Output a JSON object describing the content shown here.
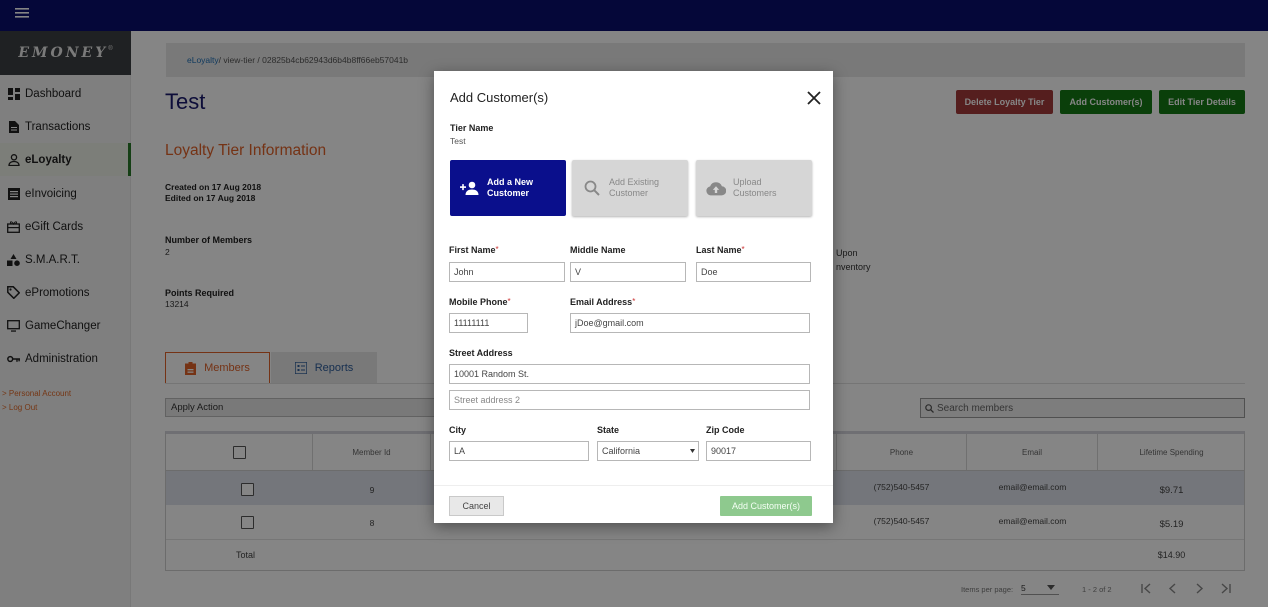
{
  "app": {
    "logo": "EMONEY",
    "logo_mark": "®"
  },
  "sidebar": {
    "items": [
      {
        "label": "Dashboard",
        "icon": "dashboard-icon"
      },
      {
        "label": "Transactions",
        "icon": "document-icon"
      },
      {
        "label": "eLoyalty",
        "icon": "person-icon",
        "active": true
      },
      {
        "label": "eInvoicing",
        "icon": "invoice-icon"
      },
      {
        "label": "eGift Cards",
        "icon": "gift-icon"
      },
      {
        "label": "S.M.A.R.T.",
        "icon": "shapes-icon"
      },
      {
        "label": "ePromotions",
        "icon": "tag-icon"
      },
      {
        "label": "GameChanger",
        "icon": "monitor-icon"
      },
      {
        "label": "Administration",
        "icon": "key-icon"
      }
    ],
    "personal_account": "> Personal Account",
    "log_out": "> Log Out"
  },
  "breadcrumb": {
    "root": "eLoyalty",
    "path": " / view-tier / 02825b4cb62943d6b4b8ff66eb57041b"
  },
  "page": {
    "title": "Test",
    "section_title": "Loyalty Tier Information",
    "created": "Created on 17 Aug 2018",
    "edited": "Edited on 17 Aug 2018",
    "members_label": "Number of Members",
    "members_value": "2",
    "points_label": "Points Required",
    "points_value": "13214",
    "partial_1": "Upon",
    "partial_2": "nventory"
  },
  "actions": {
    "delete": "Delete Loyalty Tier",
    "add_customers": "Add Customer(s)",
    "edit": "Edit Tier Details",
    "delete_color": "#a33a3a",
    "green_color": "#157a15"
  },
  "tabs": [
    {
      "label": "Members",
      "active": true
    },
    {
      "label": "Reports",
      "active": false
    }
  ],
  "toolbar": {
    "apply_action": "Apply Action",
    "search_placeholder": "Search members"
  },
  "table": {
    "headers": [
      "Member Id",
      "Phone",
      "Email",
      "Lifetime Spending"
    ],
    "rows": [
      {
        "id": "9",
        "phone": "(752)540-5457",
        "email": "email@email.com",
        "spending": "$9.71"
      },
      {
        "id": "8",
        "phone": "(752)540-5457",
        "email": "email@email.com",
        "spending": "$5.19"
      }
    ],
    "total_label": "Total",
    "total_value": "$14.90"
  },
  "pagination": {
    "items_per_page_label": "Items per page:",
    "items_per_page": "5",
    "range": "1 - 2 of 2"
  },
  "modal": {
    "title": "Add Customer(s)",
    "tier_label": "Tier Name",
    "tier_value": "Test",
    "options": [
      {
        "line1": "Add a New",
        "line2": "Customer",
        "icon": "add-person-icon",
        "active": true
      },
      {
        "line1": "Add Existing",
        "line2": "Customer",
        "icon": "search-icon",
        "active": false
      },
      {
        "line1": "Upload",
        "line2": "Customers",
        "icon": "cloud-upload-icon",
        "active": false
      }
    ],
    "fields": {
      "first_name": {
        "label": "First Name",
        "value": "John"
      },
      "middle_name": {
        "label": "Middle Name",
        "value": "V"
      },
      "last_name": {
        "label": "Last Name",
        "value": "Doe"
      },
      "mobile_phone": {
        "label": "Mobile Phone",
        "value": "11111111"
      },
      "email": {
        "label": "Email Address",
        "value": "jDoe@gmail.com"
      },
      "street": {
        "label": "Street Address",
        "value": "10001 Random St.",
        "placeholder2": "Street address 2"
      },
      "city": {
        "label": "City",
        "value": "LA"
      },
      "state": {
        "label": "State",
        "value": "California"
      },
      "zip": {
        "label": "Zip Code",
        "value": "90017"
      }
    },
    "required_mark": "*",
    "cancel": "Cancel",
    "submit": "Add Customer(s)"
  }
}
